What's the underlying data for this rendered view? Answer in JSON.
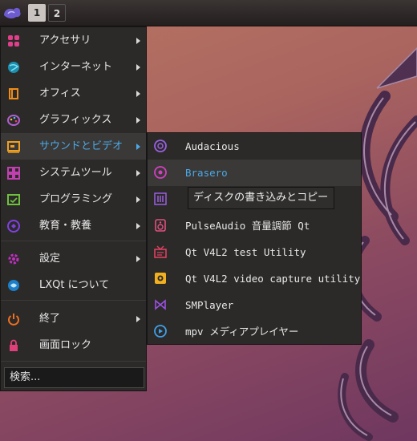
{
  "panel": {
    "start_icon": "lxqt-start-icon",
    "desktops": [
      "1",
      "2"
    ],
    "active_desktop": "1"
  },
  "menu": {
    "items": [
      {
        "label": "アクセサリ",
        "icon": "accessories-icon",
        "submenu": true
      },
      {
        "label": "インターネット",
        "icon": "internet-icon",
        "submenu": true
      },
      {
        "label": "オフィス",
        "icon": "office-icon",
        "submenu": true
      },
      {
        "label": "グラフィックス",
        "icon": "graphics-icon",
        "submenu": true
      },
      {
        "label": "サウンドとビデオ",
        "icon": "sound-video-icon",
        "submenu": true,
        "active": true
      },
      {
        "label": "システムツール",
        "icon": "system-tools-icon",
        "submenu": true
      },
      {
        "label": "プログラミング",
        "icon": "programming-icon",
        "submenu": true
      },
      {
        "label": "教育・教養",
        "icon": "education-icon",
        "submenu": true
      },
      {
        "label": "設定",
        "icon": "settings-icon",
        "submenu": true
      },
      {
        "label": "LXQt について",
        "icon": "about-icon",
        "submenu": false
      },
      {
        "label": "終了",
        "icon": "power-icon",
        "submenu": true
      },
      {
        "label": "画面ロック",
        "icon": "lock-icon",
        "submenu": false
      }
    ],
    "search_placeholder": "検索..."
  },
  "submenu": {
    "items": [
      {
        "label": "Audacious",
        "icon": "audacious-icon"
      },
      {
        "label": "Brasero",
        "icon": "brasero-icon",
        "active": true
      },
      {
        "label": "",
        "icon": "equalizer-icon"
      },
      {
        "label": "PulseAudio 音量調節 Qt",
        "icon": "pulseaudio-icon"
      },
      {
        "label": "Qt V4L2 test Utility",
        "icon": "qv4l2-icon"
      },
      {
        "label": "Qt V4L2 video capture utility",
        "icon": "video-capture-icon"
      },
      {
        "label": "SMPlayer",
        "icon": "smplayer-icon"
      },
      {
        "label": "mpv メディアプレイヤー",
        "icon": "mpv-icon"
      }
    ]
  },
  "tooltip": "ディスクの書き込みとコピー",
  "colors": {
    "accent": "#4aa9e8",
    "menu_bg": "#2b2a29",
    "panel_bg": "#2a2524"
  }
}
